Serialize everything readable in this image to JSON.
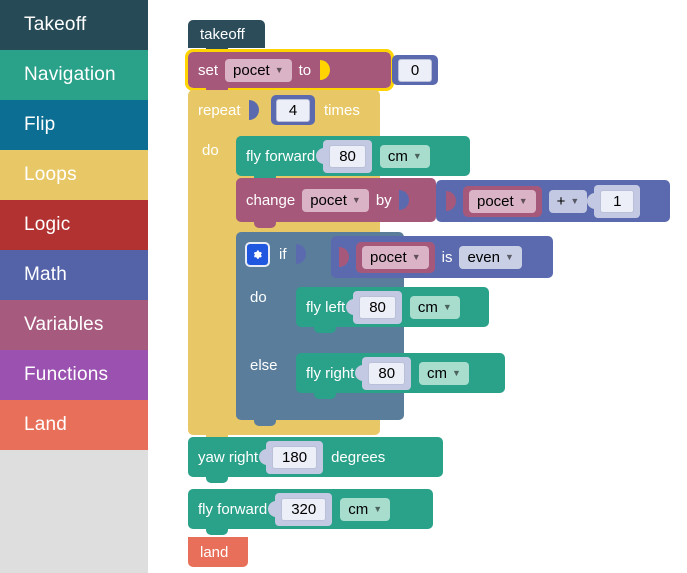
{
  "sidebar": {
    "items": [
      {
        "label": "Takeoff",
        "color": "#274a57"
      },
      {
        "label": "Navigation",
        "color": "#2aa189"
      },
      {
        "label": "Flip",
        "color": "#0b6e92"
      },
      {
        "label": "Loops",
        "color": "#e8c866"
      },
      {
        "label": "Logic",
        "color": "#b23232"
      },
      {
        "label": "Math",
        "color": "#5463a8"
      },
      {
        "label": "Variables",
        "color": "#a65b7e"
      },
      {
        "label": "Functions",
        "color": "#9b51b0"
      },
      {
        "label": "Land",
        "color": "#e8705a"
      }
    ],
    "background": "#dedede"
  },
  "workspace": {
    "blocks": {
      "takeoff": {
        "label": "takeoff"
      },
      "set_var": {
        "set_label": "set",
        "variable": "pocet",
        "to_label": "to",
        "value": "0",
        "selected": true,
        "highlight_color": "#ffd400"
      },
      "repeat": {
        "repeat_label": "repeat",
        "times_value": "4",
        "times_label": "times",
        "do_label": "do"
      },
      "fly_forward_1": {
        "action": "fly forward",
        "value": "80",
        "unit": "cm"
      },
      "change_var": {
        "change_label": "change",
        "variable": "pocet",
        "by_label": "by",
        "expr_left": "pocet",
        "operator": "+",
        "expr_right": "1"
      },
      "if_block": {
        "gear_icon": "gear-icon",
        "if_label": "if",
        "test_variable": "pocet",
        "is_label": "is",
        "parity": "even",
        "do_label": "do",
        "else_label": "else"
      },
      "fly_left": {
        "action": "fly left",
        "value": "80",
        "unit": "cm"
      },
      "fly_right": {
        "action": "fly right",
        "value": "80",
        "unit": "cm"
      },
      "yaw_right": {
        "action": "yaw right",
        "value": "180",
        "unit_label": "degrees"
      },
      "fly_forward_2": {
        "action": "fly forward",
        "value": "320",
        "unit": "cm"
      },
      "land": {
        "label": "land"
      }
    },
    "colors": {
      "takeoff": "#2c4c5a",
      "navigation": "#2aa189",
      "loops": "#e8c866",
      "variables": "#a6587b",
      "math": "#5b6aae",
      "logic": "#5a7d9c",
      "land": "#e8705a"
    }
  }
}
